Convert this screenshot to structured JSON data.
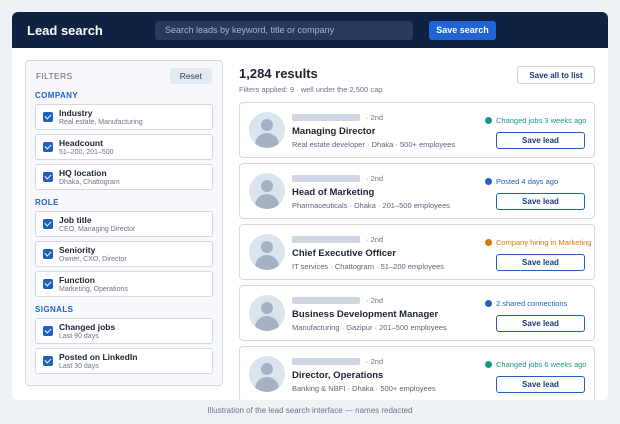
{
  "topbar": {
    "title": "Lead search",
    "search_placeholder": "Search leads by keyword, title or company",
    "save_search_label": "Save search"
  },
  "filters": {
    "heading": "FILTERS",
    "reset_label": "Reset",
    "groups": [
      {
        "title": "COMPANY",
        "items": [
          {
            "name": "Industry",
            "value": "Real estate, Manufacturing",
            "checked": true
          },
          {
            "name": "Headcount",
            "value": "51–200, 201–500",
            "checked": true
          },
          {
            "name": "HQ location",
            "value": "Dhaka, Chattogram",
            "checked": true
          }
        ]
      },
      {
        "title": "ROLE",
        "items": [
          {
            "name": "Job title",
            "value": "CEO, Managing Director",
            "checked": true
          },
          {
            "name": "Seniority",
            "value": "Owner, CXO, Director",
            "checked": true
          },
          {
            "name": "Function",
            "value": "Marketing, Operations",
            "checked": true
          }
        ]
      },
      {
        "title": "SIGNALS",
        "items": [
          {
            "name": "Changed jobs",
            "value": "Last 90 days",
            "checked": true
          },
          {
            "name": "Posted on LinkedIn",
            "value": "Last 30 days",
            "checked": true
          }
        ]
      }
    ]
  },
  "results": {
    "count_label": "1,284 results",
    "meta": "Filters applied: 9  ·  well under the 2,500 cap",
    "save_all_label": "Save all to list",
    "items": [
      {
        "degree": "· 2nd",
        "title": "Managing Director",
        "sub": "Real estate developer · Dhaka  ·  500+ employees",
        "signal": "Changed jobs 3 weeks ago",
        "signal_color": "#16998a",
        "save_label": "Save lead"
      },
      {
        "degree": "· 2nd",
        "title": "Head of Marketing",
        "sub": "Pharmaceuticals · Dhaka  ·  201–500 employees",
        "signal": "Posted 4 days ago",
        "signal_color": "#1f5fbf",
        "save_label": "Save lead"
      },
      {
        "degree": "· 2nd",
        "title": "Chief Executive Officer",
        "sub": "IT services · Chattogram  ·  51–200 employees",
        "signal": "Company hiring in Marketing",
        "signal_color": "#d9740f",
        "save_label": "Save lead"
      },
      {
        "degree": "· 2nd",
        "title": "Business Development Manager",
        "sub": "Manufacturing · Gazipur  ·  201–500 employees",
        "signal": "2 shared connections",
        "signal_color": "#1f5fbf",
        "save_label": "Save lead"
      },
      {
        "degree": "· 2nd",
        "title": "Director, Operations",
        "sub": "Banking & NBFI · Dhaka  ·  500+ employees",
        "signal": "Changed jobs 6 weeks ago",
        "signal_color": "#16998a",
        "save_label": "Save lead"
      }
    ]
  },
  "caption": "Illustration of the lead search interface — names redacted"
}
